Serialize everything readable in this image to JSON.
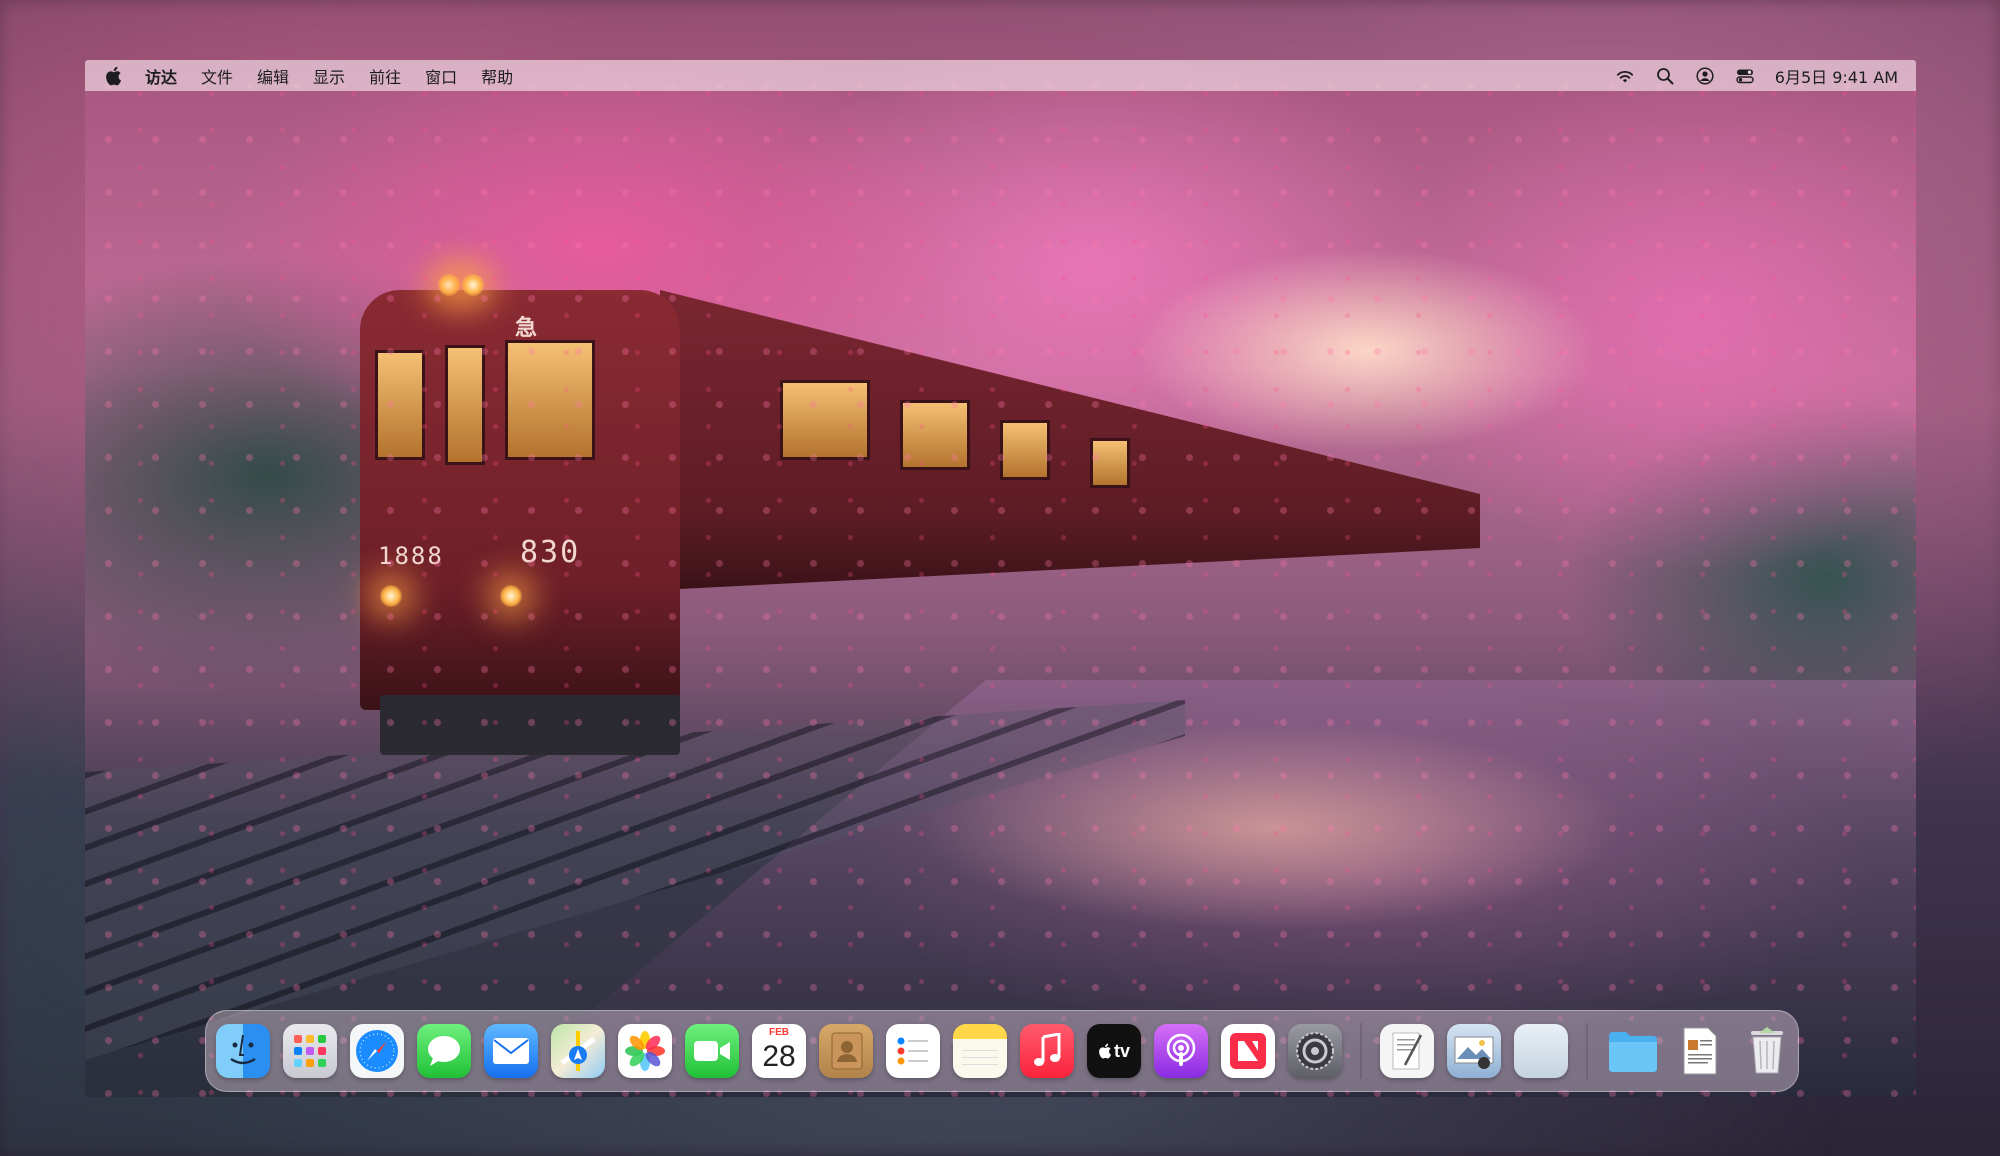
{
  "menubar": {
    "app_name": "访达",
    "menus": [
      "文件",
      "编辑",
      "显示",
      "前往",
      "窗口",
      "帮助"
    ],
    "clock": "6月5日 9:41 AM"
  },
  "wallpaper": {
    "train_front_number": "830",
    "train_side_number": "1888",
    "train_headsign": "急"
  },
  "dock": {
    "apps": [
      {
        "name": "Finder",
        "icon": "finder-icon"
      },
      {
        "name": "Launchpad",
        "icon": "launchpad-icon"
      },
      {
        "name": "Safari",
        "icon": "safari-icon"
      },
      {
        "name": "Messages",
        "icon": "messages-icon"
      },
      {
        "name": "Mail",
        "icon": "mail-icon"
      },
      {
        "name": "Maps",
        "icon": "maps-icon"
      },
      {
        "name": "Photos",
        "icon": "photos-icon"
      },
      {
        "name": "FaceTime",
        "icon": "facetime-icon"
      },
      {
        "name": "Calendar",
        "icon": "calendar-icon",
        "month": "FEB",
        "day": "28"
      },
      {
        "name": "Contacts",
        "icon": "contacts-icon"
      },
      {
        "name": "Reminders",
        "icon": "reminders-icon"
      },
      {
        "name": "Notes",
        "icon": "notes-icon"
      },
      {
        "name": "Music",
        "icon": "music-icon"
      },
      {
        "name": "TV",
        "icon": "tv-icon",
        "label": "tv"
      },
      {
        "name": "Podcasts",
        "icon": "podcasts-icon"
      },
      {
        "name": "News",
        "icon": "news-icon"
      },
      {
        "name": "System Settings",
        "icon": "settings-icon"
      }
    ],
    "recents": [
      {
        "name": "TextEdit",
        "icon": "textedit-icon"
      },
      {
        "name": "Preview",
        "icon": "preview-icon"
      },
      {
        "name": "App Window",
        "icon": "blank-window-icon"
      }
    ],
    "stacks": [
      {
        "name": "Folder",
        "icon": "folder-icon"
      },
      {
        "name": "Document",
        "icon": "document-icon"
      },
      {
        "name": "Trash",
        "icon": "trash-icon"
      }
    ]
  },
  "colors": {
    "menubar_bg": "#ecd2de",
    "accent": "#0a84ff"
  }
}
